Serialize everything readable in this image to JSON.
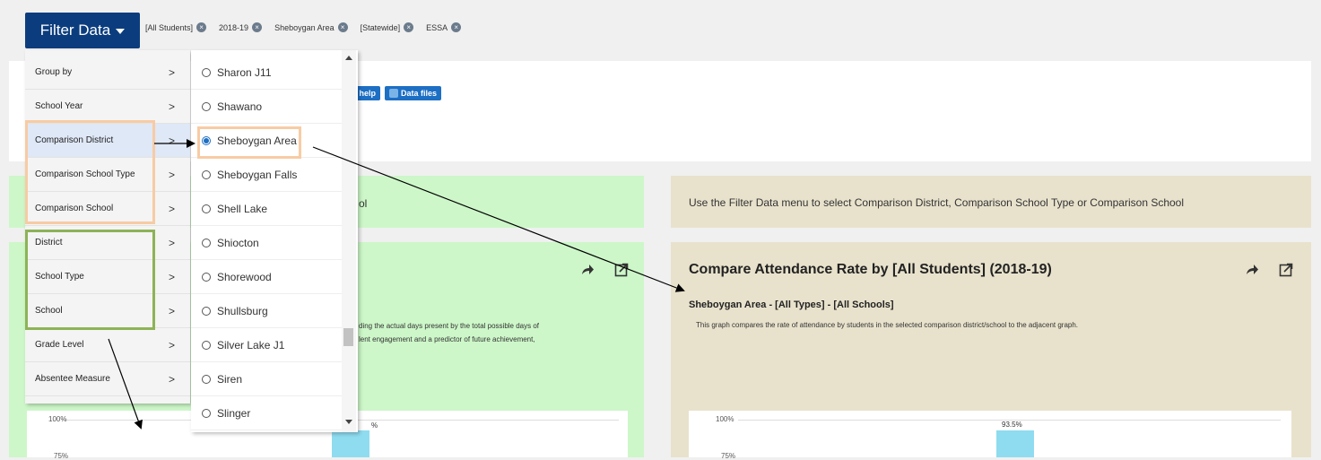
{
  "filter_button": {
    "label": "Filter Data"
  },
  "chips": [
    {
      "label": "[All Students]"
    },
    {
      "label": "2018-19"
    },
    {
      "label": "Sheboygan Area"
    },
    {
      "label": "[Statewide]"
    },
    {
      "label": "ESSA"
    }
  ],
  "help_buttons": [
    {
      "label": "et help"
    },
    {
      "label": "Data files"
    }
  ],
  "menu": {
    "items": [
      {
        "label": "Group by"
      },
      {
        "label": "School Year"
      },
      {
        "label": "Comparison District"
      },
      {
        "label": "Comparison School Type"
      },
      {
        "label": "Comparison School"
      },
      {
        "label": "District"
      },
      {
        "label": "School Type"
      },
      {
        "label": "School"
      },
      {
        "label": "Grade Level"
      },
      {
        "label": "Absentee Measure"
      }
    ],
    "chevron": ">"
  },
  "submenu": {
    "items": [
      {
        "label": "Sharon J11",
        "selected": false
      },
      {
        "label": "Shawano",
        "selected": false
      },
      {
        "label": "Sheboygan Area",
        "selected": true
      },
      {
        "label": "Sheboygan Falls",
        "selected": false
      },
      {
        "label": "Shell Lake",
        "selected": false
      },
      {
        "label": "Shiocton",
        "selected": false
      },
      {
        "label": "Shorewood",
        "selected": false
      },
      {
        "label": "Shullsburg",
        "selected": false
      },
      {
        "label": "Silver Lake J1",
        "selected": false
      },
      {
        "label": "Siren",
        "selected": false
      },
      {
        "label": "Slinger",
        "selected": false
      }
    ]
  },
  "left_strip": {
    "text": "ol"
  },
  "right_strip": {
    "text": "Use the Filter Data menu to select Comparison District, Comparison School Type or Comparison School"
  },
  "left_card": {
    "desc_line1": "ding the actual days present by the total possible days of",
    "desc_line2": "lent engagement and a predictor of future achievement,",
    "axis_top": "100%",
    "axis_second": "75%",
    "bar_label": "%"
  },
  "right_card": {
    "title": "Compare Attendance Rate by [All Students] (2018-19)",
    "subtitle": "Sheboygan Area - [All Types] - [All Schools]",
    "desc": "This graph compares the rate of attendance by students in the selected comparison district/school to the adjacent graph.",
    "axis_top": "100%",
    "axis_second": "75%",
    "bar_label": "93.5%"
  },
  "icons": {
    "share": "share-icon",
    "expand": "expand-icon",
    "close": "close-circle-icon"
  },
  "colors": {
    "filter_button": "#0b3d7e",
    "green_panel": "#cdf7c9",
    "tan_panel": "#e8e2cc",
    "highlight_orange": "#f8cba4",
    "highlight_green": "#8db356",
    "radio_selected": "#1d6fc4",
    "bar": "#8fdcf0"
  }
}
